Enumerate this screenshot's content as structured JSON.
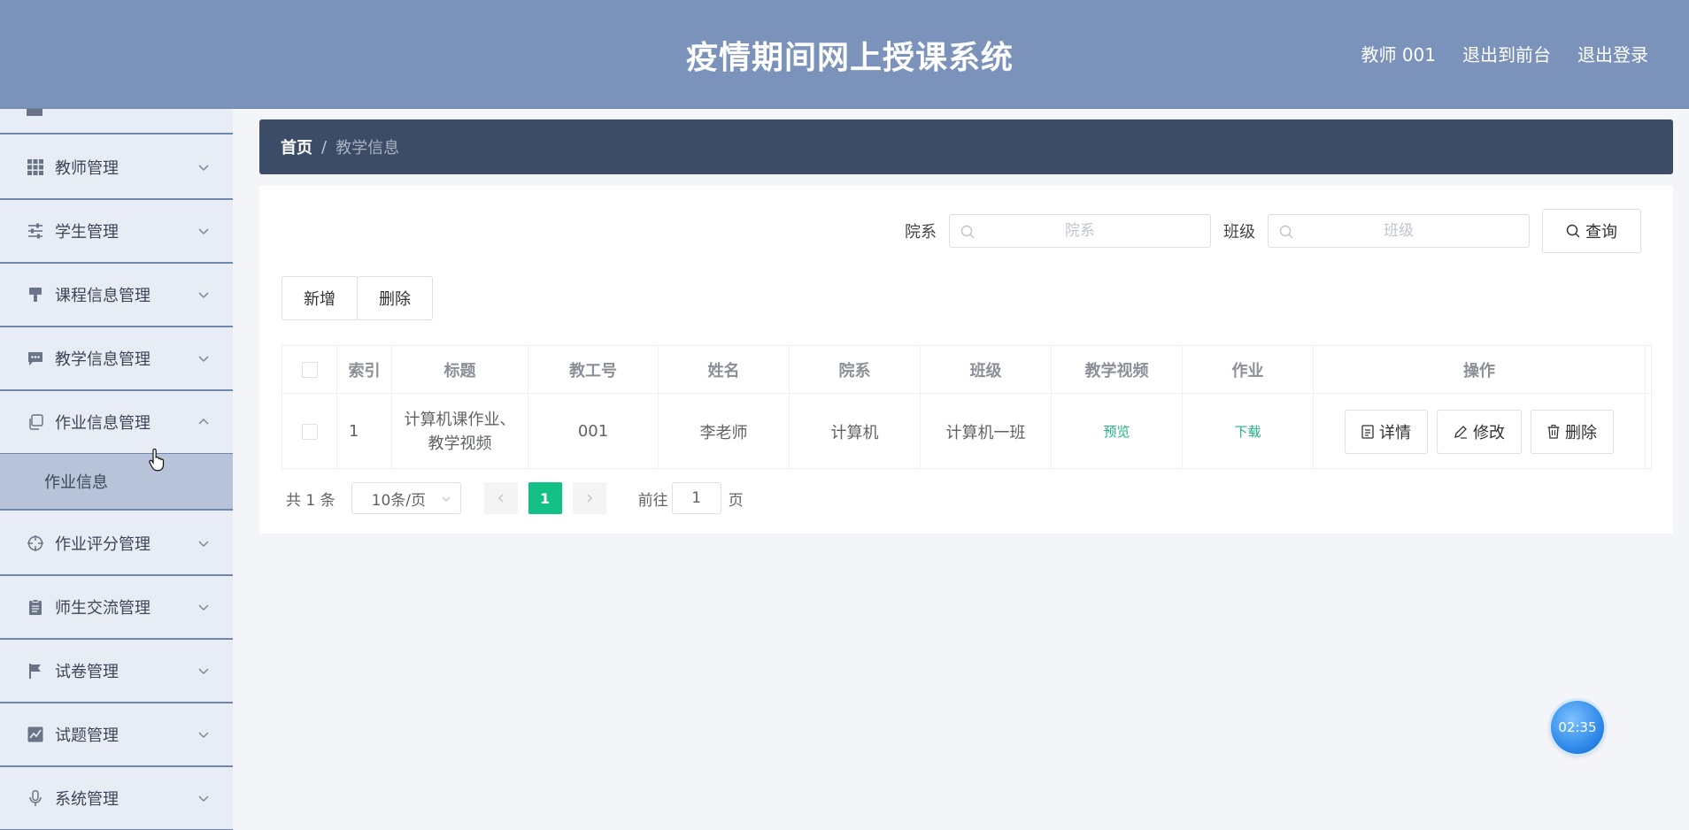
{
  "header": {
    "title": "疫情期间网上授课系统",
    "user": "教师 001",
    "to_frontend": "退出到前台",
    "logout": "退出登录"
  },
  "sidebar": {
    "items": [
      {
        "label": "教师管理",
        "icon": "grid-icon"
      },
      {
        "label": "学生管理",
        "icon": "sliders-icon"
      },
      {
        "label": "课程信息管理",
        "icon": "brush-icon"
      },
      {
        "label": "教学信息管理",
        "icon": "chat-icon"
      },
      {
        "label": "作业信息管理",
        "icon": "copy-icon",
        "expanded": true
      },
      {
        "label": "作业评分管理",
        "icon": "target-icon"
      },
      {
        "label": "师生交流管理",
        "icon": "clipboard-icon"
      },
      {
        "label": "试卷管理",
        "icon": "flag-icon"
      },
      {
        "label": "试题管理",
        "icon": "chart-icon"
      },
      {
        "label": "系统管理",
        "icon": "mic-icon"
      }
    ],
    "submenu": {
      "label": "作业信息"
    }
  },
  "breadcrumb": {
    "home": "首页",
    "separator": "/",
    "current": "教学信息"
  },
  "search": {
    "dept_label": "院系",
    "dept_placeholder": "院系",
    "class_label": "班级",
    "class_placeholder": "班级",
    "query_button": "查询"
  },
  "actions": {
    "add": "新增",
    "delete": "删除"
  },
  "table": {
    "headers": [
      "索引",
      "标题",
      "教工号",
      "姓名",
      "院系",
      "班级",
      "教学视频",
      "作业",
      "操作"
    ],
    "rows": [
      {
        "index": "1",
        "title": "计算机课作业、教学视频",
        "teacher_no": "001",
        "name": "李老师",
        "dept": "计算机",
        "class": "计算机一班",
        "video": "预览",
        "homework": "下载",
        "detail": "详情",
        "edit": "修改",
        "delete": "删除"
      }
    ]
  },
  "pagination": {
    "total": "共 1 条",
    "page_size": "10条/页",
    "current_page": "1",
    "goto_label": "前往",
    "goto_value": "1",
    "page_unit": "页"
  },
  "timer": {
    "text": "02:35"
  },
  "colors": {
    "header": "#7b93bb",
    "sidebar": "#e8ecf4",
    "breadcrumb": "#3d4c66",
    "accent": "#13c085"
  }
}
